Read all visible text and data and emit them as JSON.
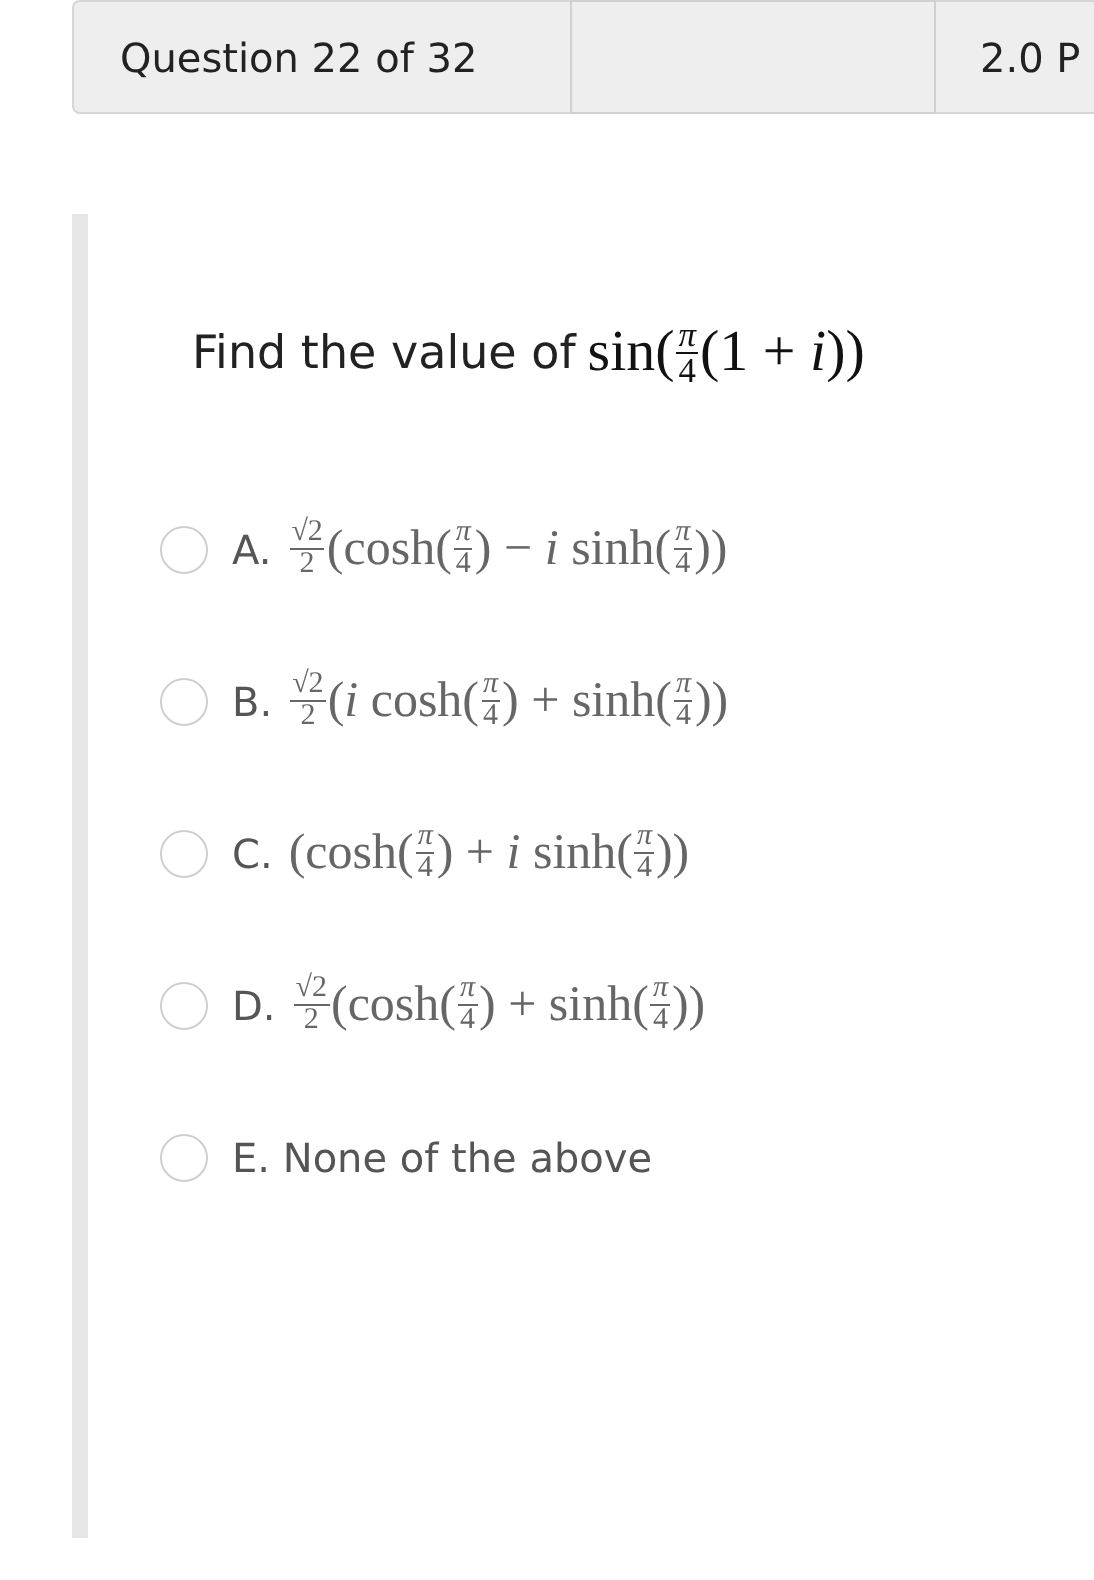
{
  "header": {
    "question_counter": "Question 22 of 32",
    "points": "2.0 P"
  },
  "question": {
    "prefix": "Find the value of",
    "formula": [
      {
        "kind": "text",
        "text": "sin("
      },
      {
        "kind": "frac",
        "num": "*π*",
        "den": "4"
      },
      {
        "kind": "text",
        "text": "(1 + *i*))"
      }
    ]
  },
  "options": [
    {
      "label": "A.",
      "selected": false,
      "formula": [
        {
          "kind": "frac",
          "num": "√2",
          "den": "2"
        },
        {
          "kind": "text",
          "text": "(cosh("
        },
        {
          "kind": "frac",
          "num": "*π*",
          "den": "4"
        },
        {
          "kind": "text",
          "text": ") − *i* sinh("
        },
        {
          "kind": "frac",
          "num": "*π*",
          "den": "4"
        },
        {
          "kind": "text",
          "text": "))"
        }
      ]
    },
    {
      "label": "B.",
      "selected": false,
      "formula": [
        {
          "kind": "frac",
          "num": "√2",
          "den": "2"
        },
        {
          "kind": "text",
          "text": "(*i* cosh("
        },
        {
          "kind": "frac",
          "num": "*π*",
          "den": "4"
        },
        {
          "kind": "text",
          "text": ") + sinh("
        },
        {
          "kind": "frac",
          "num": "*π*",
          "den": "4"
        },
        {
          "kind": "text",
          "text": "))"
        }
      ]
    },
    {
      "label": "C.",
      "selected": false,
      "formula": [
        {
          "kind": "text",
          "text": "(cosh("
        },
        {
          "kind": "frac",
          "num": "*π*",
          "den": "4"
        },
        {
          "kind": "text",
          "text": ") + *i* sinh("
        },
        {
          "kind": "frac",
          "num": "*π*",
          "den": "4"
        },
        {
          "kind": "text",
          "text": "))"
        }
      ]
    },
    {
      "label": "D.",
      "selected": false,
      "formula": [
        {
          "kind": "frac",
          "num": "√2",
          "den": "2"
        },
        {
          "kind": "text",
          "text": "(cosh("
        },
        {
          "kind": "frac",
          "num": "*π*",
          "den": "4"
        },
        {
          "kind": "text",
          "text": ") + sinh("
        },
        {
          "kind": "frac",
          "num": "*π*",
          "den": "4"
        },
        {
          "kind": "text",
          "text": "))"
        }
      ]
    },
    {
      "label": "E. None of the above",
      "selected": false
    }
  ]
}
